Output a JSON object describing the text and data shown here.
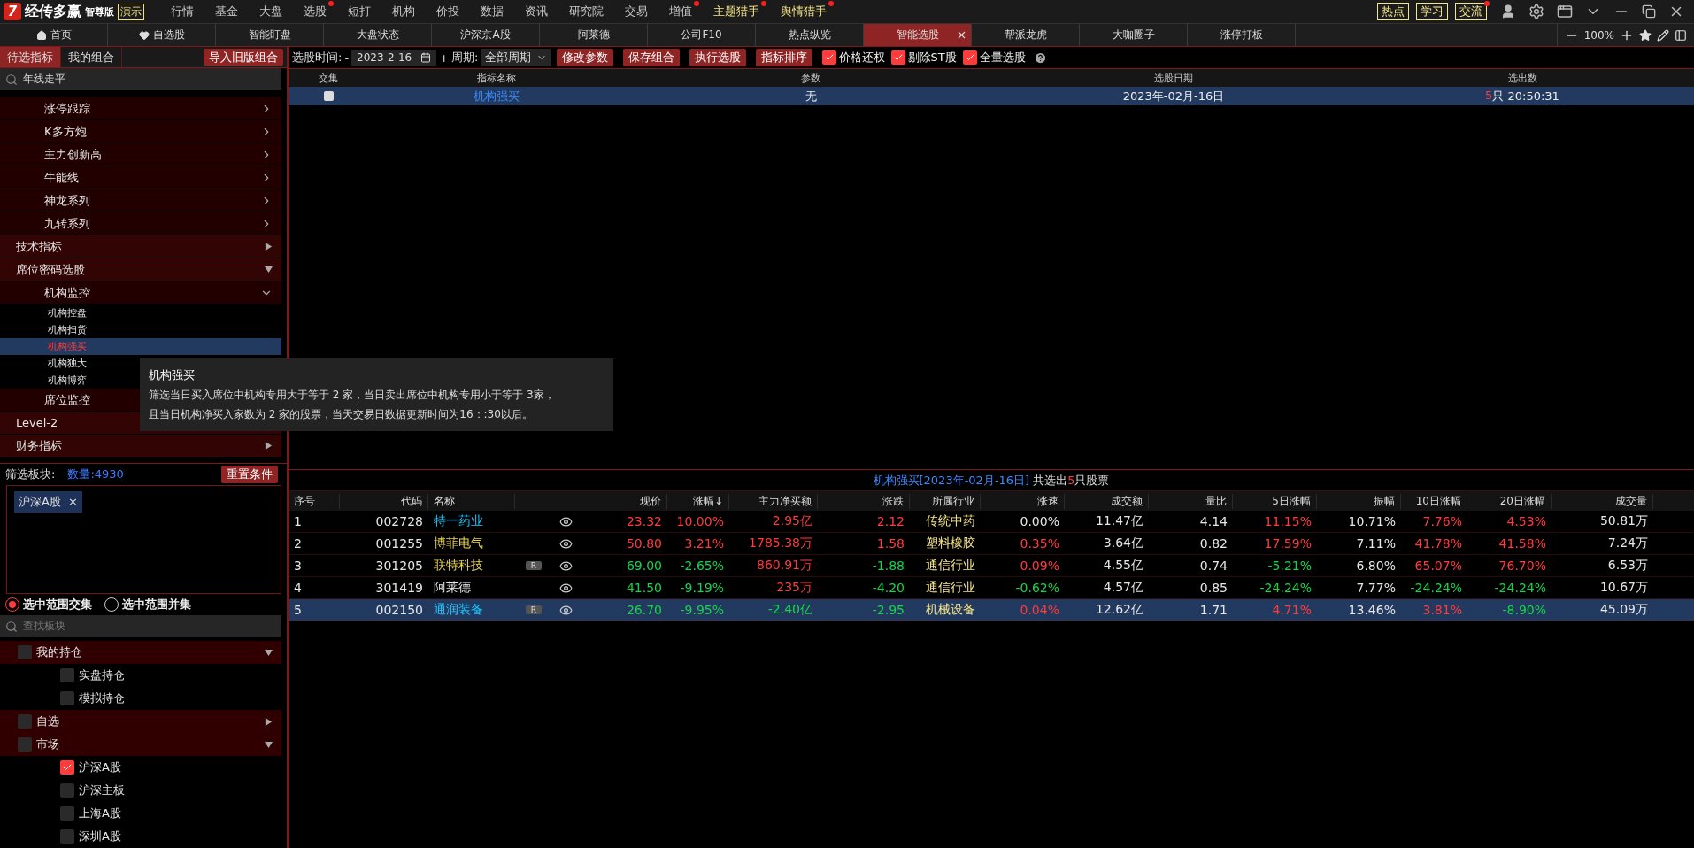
{
  "app": {
    "logo_mark": "7",
    "title": "经传多赢",
    "edition": "智尊版",
    "mode": "演示"
  },
  "menu": [
    {
      "label": "行情",
      "dot": false,
      "highlight": false
    },
    {
      "label": "基金",
      "dot": false,
      "highlight": false
    },
    {
      "label": "大盘",
      "dot": false,
      "highlight": false
    },
    {
      "label": "选股",
      "dot": true,
      "highlight": false
    },
    {
      "label": "短打",
      "dot": false,
      "highlight": false
    },
    {
      "label": "机构",
      "dot": false,
      "highlight": false
    },
    {
      "label": "价投",
      "dot": false,
      "highlight": false
    },
    {
      "label": "数据",
      "dot": false,
      "highlight": false
    },
    {
      "label": "资讯",
      "dot": false,
      "highlight": false
    },
    {
      "label": "研究院",
      "dot": false,
      "highlight": false
    },
    {
      "label": "交易",
      "dot": false,
      "highlight": false
    },
    {
      "label": "增值",
      "dot": true,
      "highlight": false
    },
    {
      "label": "主题猎手",
      "dot": true,
      "highlight": true
    },
    {
      "label": "舆情猎手",
      "dot": true,
      "highlight": true
    }
  ],
  "quick_links": [
    {
      "label": "热点",
      "dot": false
    },
    {
      "label": "学习",
      "dot": false
    },
    {
      "label": "交流",
      "dot": true
    }
  ],
  "tabs": [
    {
      "label": "首页",
      "selected": false
    },
    {
      "label": "自选股",
      "selected": false
    },
    {
      "label": "智能盯盘",
      "selected": false
    },
    {
      "label": "大盘状态",
      "selected": false
    },
    {
      "label": "沪深京A股",
      "selected": false
    },
    {
      "label": "阿莱德",
      "selected": false
    },
    {
      "label": "公司F10",
      "selected": false
    },
    {
      "label": "热点纵览",
      "selected": false
    },
    {
      "label": "智能选股",
      "selected": true
    },
    {
      "label": "帮派龙虎",
      "selected": false
    },
    {
      "label": "大咖圈子",
      "selected": false
    },
    {
      "label": "涨停打板",
      "selected": false
    }
  ],
  "zoom": "100%",
  "left_tabs": [
    {
      "label": "待选指标",
      "selected": true
    },
    {
      "label": "我的组合",
      "selected": false
    }
  ],
  "import_button": "导入旧版组合",
  "indicator_search": {
    "value": "年线走平"
  },
  "indicator_tree": [
    {
      "children": [
        {
          "label": "涨停跟踪",
          "expanded": false
        },
        {
          "label": "K多方炮",
          "expanded": false
        },
        {
          "label": "主力创新高",
          "expanded": false
        },
        {
          "label": "牛能线",
          "expanded": false
        },
        {
          "label": "神龙系列",
          "expanded": false
        },
        {
          "label": "九转系列",
          "expanded": false
        }
      ]
    },
    {
      "label": "技术指标",
      "expanded": false
    },
    {
      "label": "席位密码选股",
      "expanded": true,
      "children": [
        {
          "label": "机构监控",
          "expanded": true,
          "children": [
            {
              "label": "机构控盘",
              "selected": false
            },
            {
              "label": "机构扫货",
              "selected": false
            },
            {
              "label": "机构强买",
              "selected": true
            },
            {
              "label": "机构独大",
              "selected": false
            },
            {
              "label": "机构博弈",
              "selected": false
            }
          ]
        },
        {
          "label": "席位监控"
        }
      ]
    },
    {
      "label": "Level-2"
    },
    {
      "label": "财务指标",
      "expanded": false
    }
  ],
  "tooltip": {
    "title": "机构强买",
    "lines": [
      "筛选当日买入席位中机构专用大于等于 2 家，当日卖出席位中机构专用小于等于 3家，",
      "且当日机构净买入家数为 2 家的股票，当天交易日数据更新时间为16：:30以后。"
    ]
  },
  "filter": {
    "label": "筛选板块:",
    "count": "数量:4930",
    "reset_button": "重置条件",
    "tags": [
      "沪深A股"
    ],
    "tag_remove": "×",
    "modes": [
      {
        "label": "选中范围交集",
        "selected": true
      },
      {
        "label": "选中范围并集",
        "selected": false
      }
    ],
    "search": {
      "placeholder": "查找板块"
    },
    "tree": [
      {
        "label": "我的持仓",
        "checked": false,
        "expanded": true,
        "children": [
          {
            "label": "实盘持仓",
            "checked": false
          },
          {
            "label": "模拟持仓",
            "checked": false
          }
        ]
      },
      {
        "label": "自选",
        "checked": false,
        "expanded": false
      },
      {
        "label": "市场",
        "checked": false,
        "expanded": true,
        "children": [
          {
            "label": "沪深A股",
            "checked": true
          },
          {
            "label": "沪深主板",
            "checked": false
          },
          {
            "label": "上海A股",
            "checked": false
          },
          {
            "label": "深圳A股",
            "checked": false
          }
        ]
      }
    ]
  },
  "toolbar": {
    "date_label": "选股时间:",
    "minus": "-",
    "date": "2023-2-16",
    "plus": "+",
    "period_label": "周期:",
    "period": "全部周期",
    "buttons": [
      "修改参数",
      "保存组合",
      "执行选股",
      "指标排序"
    ],
    "options": [
      {
        "label": "价格还权",
        "checked": true
      },
      {
        "label": "剔除ST股",
        "checked": true
      },
      {
        "label": "全量选股",
        "checked": true
      }
    ]
  },
  "selection_table": {
    "columns": [
      "交集",
      "指标名称",
      "参数",
      "选股日期",
      "选出数"
    ],
    "rows": [
      {
        "checked": false,
        "name": "机构强买",
        "params": "无",
        "date": "2023年-02月-16日",
        "count": "5",
        "count_rest": "只 20:50:31",
        "selected": true
      }
    ]
  },
  "result": {
    "title": "机构强买[2023年-02月-16日]",
    "prefix": "共选出",
    "count": "5",
    "suffix": "只股票",
    "columns": [
      "序号",
      "代码",
      "名称",
      "",
      "",
      "现价",
      "涨幅↓",
      "主力净买额",
      "涨跌",
      "所属行业",
      "涨速",
      "成交额",
      "量比",
      "5日涨幅",
      "振幅",
      "10日涨幅",
      "20日涨幅",
      "成交量"
    ],
    "rows": [
      {
        "selected": false,
        "cells": [
          {
            "text": "1",
            "color": "#e6e6e6"
          },
          {
            "text": "002728",
            "color": "#e6e6e6"
          },
          {
            "text": "特一药业",
            "color": "#1ec8ff"
          },
          {
            "text": ""
          },
          {
            "watch": true
          },
          {
            "text": "23.32",
            "color": "#ff3b3b"
          },
          {
            "text": "10.00%",
            "color": "#ff3b3b"
          },
          {
            "text": "2.95亿",
            "color": "#ff3b3b"
          },
          {
            "text": "2.12",
            "color": "#ff3b3b"
          },
          {
            "text": "传统中药",
            "color": "#f6e58a"
          },
          {
            "text": "0.00%",
            "color": "#e6e6e6"
          },
          {
            "text": "11.47亿",
            "color": "#e6e6e6"
          },
          {
            "text": "4.14",
            "color": "#e6e6e6"
          },
          {
            "text": "11.15%",
            "color": "#ff3b3b"
          },
          {
            "text": "10.71%",
            "color": "#e6e6e6"
          },
          {
            "text": "7.76%",
            "color": "#ff3b3b"
          },
          {
            "text": "4.53%",
            "color": "#ff3b3b"
          },
          {
            "text": "50.81万",
            "color": "#e6e6e6"
          }
        ]
      },
      {
        "selected": false,
        "cells": [
          {
            "text": "2",
            "color": "#e6e6e6"
          },
          {
            "text": "001255",
            "color": "#e6e6e6"
          },
          {
            "text": "博菲电气",
            "color": "#e8d44d"
          },
          {
            "text": ""
          },
          {
            "watch": true
          },
          {
            "text": "50.80",
            "color": "#ff3b3b"
          },
          {
            "text": "3.21%",
            "color": "#ff3b3b"
          },
          {
            "text": "1785.38万",
            "color": "#ff3b3b"
          },
          {
            "text": "1.58",
            "color": "#ff3b3b"
          },
          {
            "text": "塑料橡胶",
            "color": "#f6e58a"
          },
          {
            "text": "0.35%",
            "color": "#ff3b3b"
          },
          {
            "text": "3.64亿",
            "color": "#e6e6e6"
          },
          {
            "text": "0.82",
            "color": "#e6e6e6"
          },
          {
            "text": "17.59%",
            "color": "#ff3b3b"
          },
          {
            "text": "7.11%",
            "color": "#e6e6e6"
          },
          {
            "text": "41.78%",
            "color": "#ff3b3b"
          },
          {
            "text": "41.58%",
            "color": "#ff3b3b"
          },
          {
            "text": "7.24万",
            "color": "#e6e6e6"
          }
        ]
      },
      {
        "selected": false,
        "cells": [
          {
            "text": "3",
            "color": "#e6e6e6"
          },
          {
            "text": "301205",
            "color": "#e6e6e6"
          },
          {
            "text": "联特科技",
            "color": "#e8d44d"
          },
          {
            "text": "R"
          },
          {
            "watch": true
          },
          {
            "text": "69.00",
            "color": "#19d24a"
          },
          {
            "text": "-2.65%",
            "color": "#19d24a"
          },
          {
            "text": "860.91万",
            "color": "#ff3b3b"
          },
          {
            "text": "-1.88",
            "color": "#19d24a"
          },
          {
            "text": "通信行业",
            "color": "#f6e58a"
          },
          {
            "text": "0.09%",
            "color": "#ff3b3b"
          },
          {
            "text": "4.55亿",
            "color": "#e6e6e6"
          },
          {
            "text": "0.74",
            "color": "#e6e6e6"
          },
          {
            "text": "-5.21%",
            "color": "#19d24a"
          },
          {
            "text": "6.80%",
            "color": "#e6e6e6"
          },
          {
            "text": "65.07%",
            "color": "#ff3b3b"
          },
          {
            "text": "76.70%",
            "color": "#ff3b3b"
          },
          {
            "text": "6.53万",
            "color": "#e6e6e6"
          }
        ]
      },
      {
        "selected": false,
        "cells": [
          {
            "text": "4",
            "color": "#e6e6e6"
          },
          {
            "text": "301419",
            "color": "#e6e6e6"
          },
          {
            "text": "阿莱德",
            "color": "#e6e6e6"
          },
          {
            "text": ""
          },
          {
            "watch": true
          },
          {
            "text": "41.50",
            "color": "#19d24a"
          },
          {
            "text": "-9.19%",
            "color": "#19d24a"
          },
          {
            "text": "235万",
            "color": "#ff3b3b"
          },
          {
            "text": "-4.20",
            "color": "#19d24a"
          },
          {
            "text": "通信行业",
            "color": "#f6e58a"
          },
          {
            "text": "-0.62%",
            "color": "#19d24a"
          },
          {
            "text": "4.57亿",
            "color": "#e6e6e6"
          },
          {
            "text": "0.85",
            "color": "#e6e6e6"
          },
          {
            "text": "-24.24%",
            "color": "#19d24a"
          },
          {
            "text": "7.77%",
            "color": "#e6e6e6"
          },
          {
            "text": "-24.24%",
            "color": "#19d24a"
          },
          {
            "text": "-24.24%",
            "color": "#19d24a"
          },
          {
            "text": "10.67万",
            "color": "#e6e6e6"
          }
        ]
      },
      {
        "selected": true,
        "cells": [
          {
            "text": "5",
            "color": "#e6e6e6"
          },
          {
            "text": "002150",
            "color": "#e6e6e6"
          },
          {
            "text": "通润装备",
            "color": "#1ec8ff"
          },
          {
            "text": "R"
          },
          {
            "watch": true
          },
          {
            "text": "26.70",
            "color": "#19d24a"
          },
          {
            "text": "-9.95%",
            "color": "#19d24a"
          },
          {
            "text": "-2.40亿",
            "color": "#19d24a"
          },
          {
            "text": "-2.95",
            "color": "#19d24a"
          },
          {
            "text": "机械设备",
            "color": "#f6e58a"
          },
          {
            "text": "0.04%",
            "color": "#ff3b3b"
          },
          {
            "text": "12.62亿",
            "color": "#e6e6e6"
          },
          {
            "text": "1.71",
            "color": "#e6e6e6"
          },
          {
            "text": "4.71%",
            "color": "#ff3b3b"
          },
          {
            "text": "13.46%",
            "color": "#e6e6e6"
          },
          {
            "text": "3.81%",
            "color": "#ff3b3b"
          },
          {
            "text": "-8.90%",
            "color": "#19d24a"
          },
          {
            "text": "45.09万",
            "color": "#e6e6e6"
          }
        ]
      }
    ]
  }
}
